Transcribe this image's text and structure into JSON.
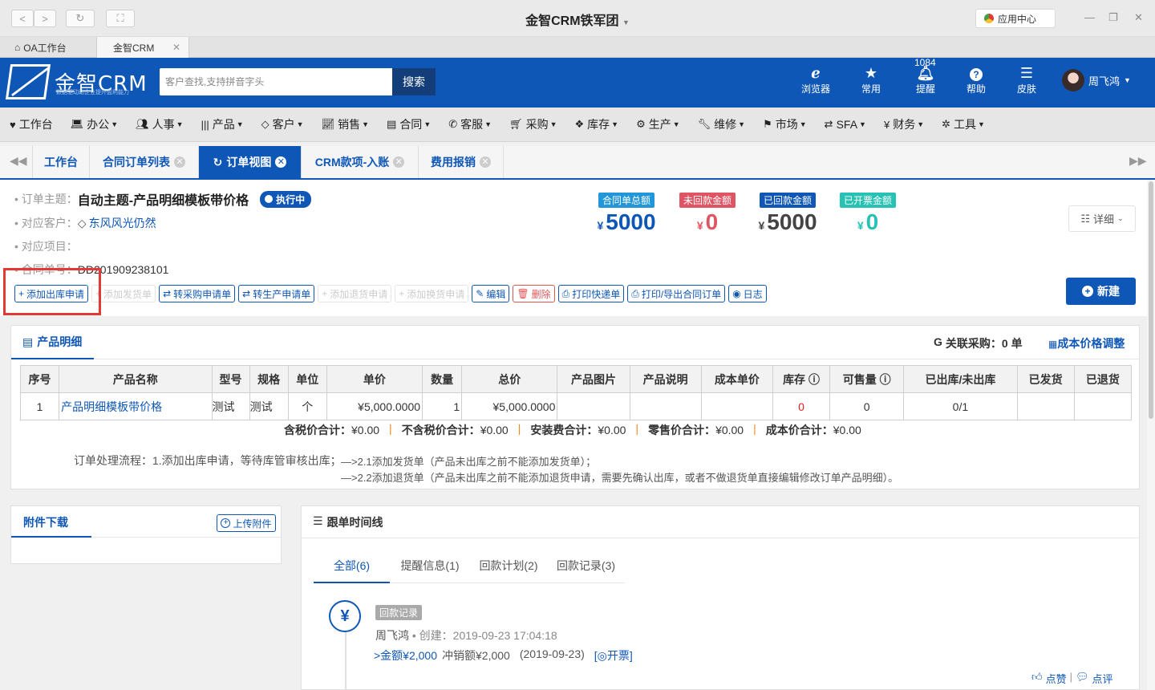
{
  "window": {
    "title": "金智CRM铁军团",
    "app_center": "应用中心"
  },
  "browser_tabs": [
    {
      "label": "OA工作台"
    },
    {
      "label": "金智CRM"
    }
  ],
  "header": {
    "logo_text": "金智CRM",
    "logo_sub": "数据驱动助企业提升盈利能力",
    "search_placeholder": "客户查找,支持拼音字头",
    "search_button": "搜索",
    "icons": [
      {
        "label": "浏览器",
        "icon": "ie-icon"
      },
      {
        "label": "常用",
        "icon": "star-icon"
      },
      {
        "label": "提醒",
        "icon": "bell-icon",
        "badge": "1084"
      },
      {
        "label": "帮助",
        "icon": "help-icon"
      },
      {
        "label": "皮肤",
        "icon": "skin-icon"
      }
    ],
    "user_name": "周飞鸿"
  },
  "menu": [
    {
      "label": "工作台",
      "icon": "heart-icon",
      "caret": false
    },
    {
      "label": "办公",
      "icon": "laptop-icon",
      "caret": true
    },
    {
      "label": "人事",
      "icon": "users-icon",
      "caret": true
    },
    {
      "label": "产品",
      "icon": "barcode-icon",
      "caret": true
    },
    {
      "label": "客户",
      "icon": "diamond-icon",
      "caret": true
    },
    {
      "label": "销售",
      "icon": "chart-icon",
      "caret": true
    },
    {
      "label": "合同",
      "icon": "contract-icon",
      "caret": true
    },
    {
      "label": "客服",
      "icon": "phone-icon",
      "caret": true
    },
    {
      "label": "采购",
      "icon": "cart-icon",
      "caret": true
    },
    {
      "label": "库存",
      "icon": "cubes-icon",
      "caret": true
    },
    {
      "label": "生产",
      "icon": "cogs-icon",
      "caret": true
    },
    {
      "label": "维修",
      "icon": "wrench-icon",
      "caret": true
    },
    {
      "label": "市场",
      "icon": "flag-icon",
      "caret": true
    },
    {
      "label": "SFA",
      "icon": "exchange-icon",
      "caret": true
    },
    {
      "label": "财务",
      "icon": "yen-icon",
      "caret": true
    },
    {
      "label": "工具",
      "icon": "gear-icon",
      "caret": true
    }
  ],
  "page_tabs": [
    {
      "label": "工作台",
      "closable": false,
      "active": false
    },
    {
      "label": "合同订单列表",
      "closable": true,
      "active": false
    },
    {
      "label": "订单视图",
      "closable": true,
      "active": true
    },
    {
      "label": "CRM款项-入账",
      "closable": true,
      "active": false
    },
    {
      "label": "费用报销",
      "closable": true,
      "active": false
    }
  ],
  "order": {
    "subject_label": "订单主题：",
    "subject": "自动主题-产品明细模板带价格",
    "status": "执行中",
    "customer_label": "对应客户：",
    "customer": "东风风光仍然",
    "project_label": "对应项目：",
    "project": "",
    "contract_no_label": "合同单号：",
    "contract_no": "DD201909238101"
  },
  "stats": [
    {
      "label": "合同单总额",
      "currency": "¥",
      "value": "5000",
      "tag_color": "#2196d9",
      "value_color": "#0f57b6"
    },
    {
      "label": "未回款金额",
      "currency": "¥",
      "value": "0",
      "tag_color": "#e05563",
      "value_color": "#e05563"
    },
    {
      "label": "已回款金额",
      "currency": "¥",
      "value": "5000",
      "tag_color": "#0f57b6",
      "value_color": "#444444"
    },
    {
      "label": "已开票金额",
      "currency": "¥",
      "value": "0",
      "tag_color": "#27c2b4",
      "value_color": "#27c2b4"
    }
  ],
  "detail_button": "详细",
  "new_button": "新建",
  "actions": [
    {
      "label": "添加出库申请",
      "icon": "+",
      "state": "normal"
    },
    {
      "label": "添加发货单",
      "icon": "+",
      "state": "disabled"
    },
    {
      "label": "转采购申请单",
      "icon": "⇄",
      "state": "normal"
    },
    {
      "label": "转生产申请单",
      "icon": "⇄",
      "state": "normal"
    },
    {
      "label": "添加退货申请",
      "icon": "+",
      "state": "disabled"
    },
    {
      "label": "添加换货申请",
      "icon": "+",
      "state": "disabled"
    },
    {
      "label": "编辑",
      "icon": "✎",
      "state": "normal"
    },
    {
      "label": "删除",
      "icon": "🗑",
      "state": "danger"
    },
    {
      "label": "打印快递单",
      "icon": "⎙",
      "state": "normal"
    },
    {
      "label": "打印/导出合同订单",
      "icon": "⎙",
      "state": "normal"
    },
    {
      "label": "日志",
      "icon": "◉",
      "state": "normal"
    }
  ],
  "products": {
    "title": "产品明细",
    "linked_purchase": "关联采购：0 单",
    "cost_adjust": "成本价格调整",
    "columns": [
      "序号",
      "产品名称",
      "型号",
      "规格",
      "单位",
      "单价",
      "数量",
      "总价",
      "产品图片",
      "产品说明",
      "成本单价",
      "库存",
      "可售量",
      "已出库/未出库",
      "已发货",
      "已退货"
    ],
    "rows": [
      [
        "1",
        "产品明细模板带价格",
        "测试",
        "测试",
        "个",
        "¥5,000.0000",
        "1",
        "¥5,000.0000",
        "",
        "",
        "",
        "0",
        "0",
        "0/1",
        "",
        ""
      ]
    ],
    "totals": [
      {
        "label": "含税价合计：",
        "value": "¥0.00"
      },
      {
        "label": "不含税价合计：",
        "value": "¥0.00"
      },
      {
        "label": "安装费合计：",
        "value": "¥0.00"
      },
      {
        "label": "零售价合计：",
        "value": "¥0.00"
      },
      {
        "label": "成本价合计：",
        "value": "¥0.00"
      }
    ],
    "flow_label": "订单处理流程：1.添加出库申请，等待库管审核出库；",
    "flow_steps": [
      "—>2.1添加发货单（产品未出库之前不能添加发货单）；",
      "—>2.2添加退货单（产品未出库之前不能添加退货申请，需要先确认出库，或者不做退货单直接编辑修改订单产品明细）。"
    ]
  },
  "attachments": {
    "title": "附件下载",
    "upload_button": "上传附件"
  },
  "timeline": {
    "title": "跟单时间线",
    "tabs": [
      "全部(6)",
      "提醒信息(1)",
      "回款计划(2)",
      "回款记录(3)"
    ],
    "record": {
      "tag": "回款记录",
      "author": "周飞鸿",
      "created": "• 创建：2019-09-23 17:04:18",
      "amount": ">金额¥2,000",
      "offset": "冲销额¥2,000",
      "date": "(2019-09-23)",
      "invoice": "[◎开票]",
      "like": "点赞",
      "comment": "点评"
    }
  }
}
